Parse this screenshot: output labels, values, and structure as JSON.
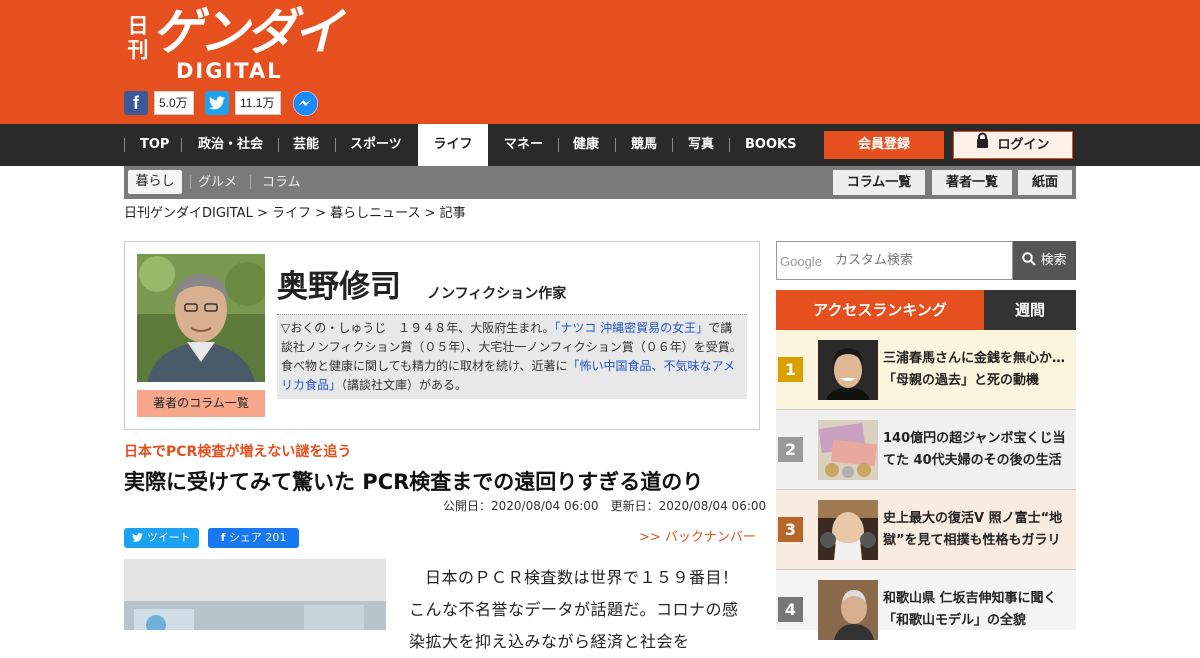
{
  "header": {
    "logo_kanji": "日刊",
    "logo_main": "ゲンダイ",
    "logo_sub": "DIGITAL",
    "facebook_count": "5.0万",
    "twitter_count": "11.1万"
  },
  "nav": {
    "items": [
      "TOP",
      "政治・社会",
      "芸能",
      "スポーツ",
      "ライフ",
      "マネー",
      "健康",
      "競馬",
      "写真",
      "BOOKS"
    ],
    "active": "ライフ",
    "register_label": "会員登録",
    "login_label": "ログイン"
  },
  "subnav": {
    "items": [
      "暮らし",
      "グルメ",
      "コラム"
    ],
    "buttons": [
      "コラム一覧",
      "著者一覧",
      "紙面"
    ]
  },
  "breadcrumb": "日刊ゲンダイDIGITAL > ライフ > 暮らしニュース > 記事",
  "author": {
    "name": "奥野修司",
    "title": "ノンフィクション作家",
    "bio_1": "▽おくの・しゅうじ　１９４８年、大阪府生まれ。",
    "bio_link_1": "「ナツコ 沖縄密貿易の女王」",
    "bio_2": "で講談社ノンフィクション賞（０５年）、大宅壮一ノンフィクション賞（０６年）を受賞。食べ物と健康に関しても精力的に取材を続け、近著に",
    "bio_link_2": "「怖い中国食品、不気味なアメリカ食品」",
    "bio_3": "（講談社文庫）がある。",
    "column_list_label": "著者のコラム一覧"
  },
  "article": {
    "kicker": "日本でPCR検査が増えない謎を追う",
    "headline": "実際に受けてみて驚いた PCR検査までの遠回りすぎる道のり",
    "published": "公開日：2020/08/04 06:00",
    "updated": "更新日：2020/08/04 06:00",
    "tweet_label": "ツイート",
    "share_label": "シェア 201",
    "backnumber_label": ">> バックナンバー",
    "body": "日本のＰＣＲ検査数は世界で１５９番目！　こんな不名誉なデータが話題だ。コロナの感染拡大を抑え込みながら経済と社会を"
  },
  "sidebar": {
    "search_google": "Google",
    "search_placeholder": "カスタム検索",
    "search_button": "検索",
    "tab_access": "アクセスランキング",
    "tab_week": "週間",
    "ranking": [
      {
        "rank": "1",
        "title": "三浦春馬さんに金銭を無心か…「母親の過去」と死の動機",
        "color": "#d9a000"
      },
      {
        "rank": "2",
        "title": "140億円の超ジャンボ宝くじ当てた 40代夫婦のその後の生活",
        "color": "#999999"
      },
      {
        "rank": "3",
        "title": "史上最大の復活V 照ノ富士“地獄”を見て相撲も性格もガラリ",
        "color": "#b8652a"
      },
      {
        "rank": "4",
        "title": "和歌山県 仁坂吉伸知事に聞く「和歌山モデル」の全貌",
        "color": "#777777"
      }
    ]
  },
  "colors": {
    "brand": "#e64f1e",
    "nav_bg": "#2a2a2a",
    "subnav_bg": "#7a7a7a"
  }
}
